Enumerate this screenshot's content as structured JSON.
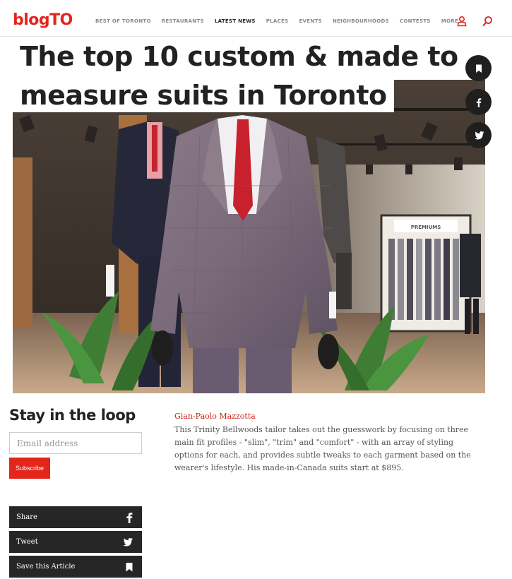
{
  "header": {
    "logo": "blogTO",
    "nav": [
      {
        "label": "BEST OF TORONTO",
        "active": false
      },
      {
        "label": "RESTAURANTS",
        "active": false
      },
      {
        "label": "LATEST NEWS",
        "active": true
      },
      {
        "label": "PLACES",
        "active": false
      },
      {
        "label": "EVENTS",
        "active": false
      },
      {
        "label": "NEIGHBOURHOODS",
        "active": false
      },
      {
        "label": "CONTESTS",
        "active": false
      },
      {
        "label": "MORE",
        "active": false
      }
    ],
    "icons": [
      "user-icon",
      "search-icon"
    ],
    "accent_color": "#e3251b"
  },
  "article": {
    "title_line1": "The top 10 custom & made to",
    "title_line2": "measure suits in Toronto",
    "author": "Gian-Paolo Mazzotta",
    "body": "This Trinity Bellwoods tailor takes out the guesswork by focusing on three main fit profiles - \"slim\", \"trim\" and \"comfort\" - with an array of styling options for each, and provides subtle tweaks to each garment based on the wearer's lifestyle. His made-in-Canada suits start at $895."
  },
  "hero": {
    "store_sign": "PREMIUMS"
  },
  "floating_actions": [
    "bookmark-icon",
    "facebook-icon",
    "twitter-icon"
  ],
  "newsletter": {
    "title": "Stay in the loop",
    "email_placeholder": "Email address",
    "subscribe_label": "Subscribe"
  },
  "share": {
    "share_label": "Share",
    "tweet_label": "Tweet",
    "save_label": "Save this Article"
  }
}
